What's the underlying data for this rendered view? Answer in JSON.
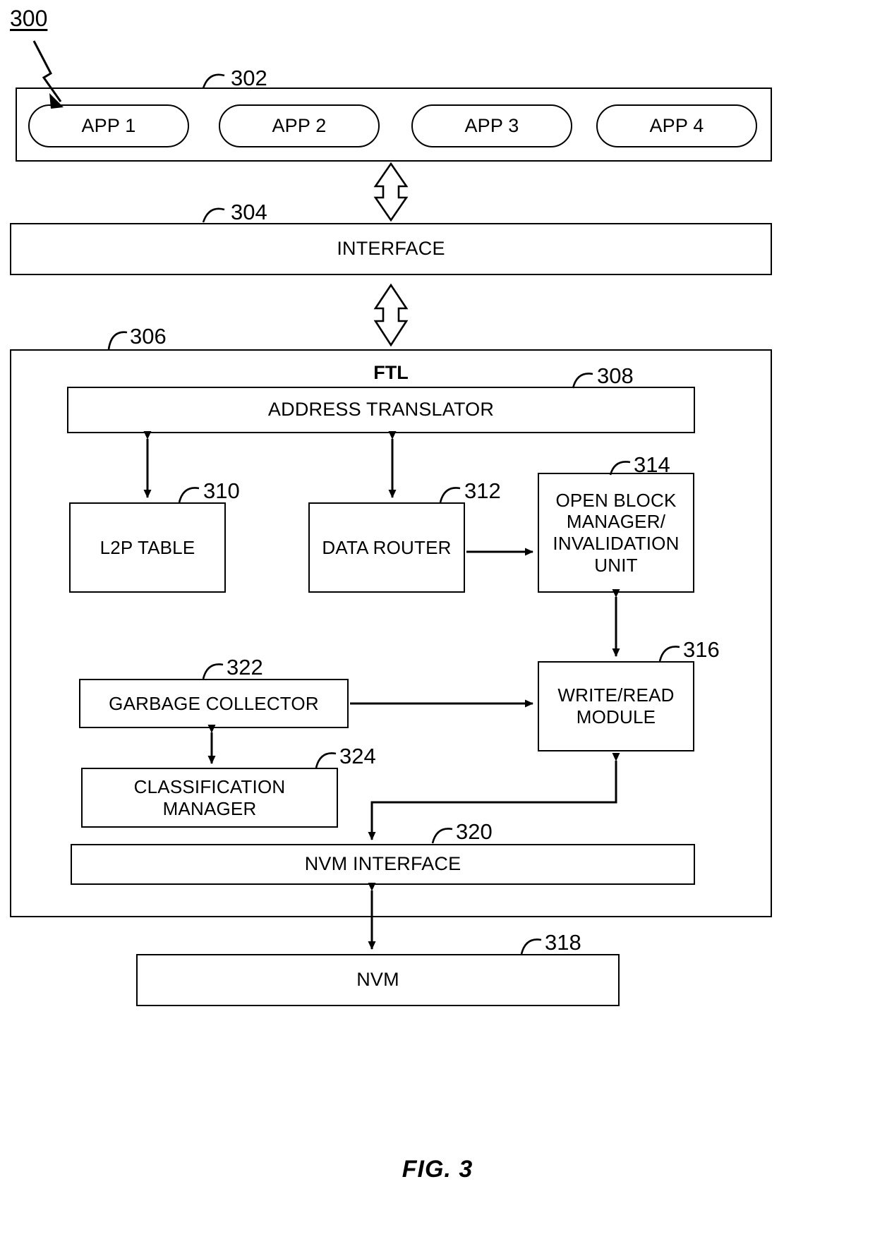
{
  "figure": {
    "caption": "FIG. 3",
    "system_numeral": "300"
  },
  "blocks": {
    "app_layer": {
      "numeral": "302",
      "apps": [
        {
          "label": "APP 1"
        },
        {
          "label": "APP 2"
        },
        {
          "label": "APP 3"
        },
        {
          "label": "APP 4"
        }
      ]
    },
    "interface": {
      "numeral": "304",
      "label": "INTERFACE"
    },
    "ftl": {
      "numeral": "306",
      "label": "FTL"
    },
    "address_translator": {
      "numeral": "308",
      "label": "ADDRESS TRANSLATOR"
    },
    "l2p_table": {
      "numeral": "310",
      "label": "L2P TABLE"
    },
    "data_router": {
      "numeral": "312",
      "label": "DATA ROUTER"
    },
    "open_block_manager": {
      "numeral": "314",
      "label": "OPEN BLOCK\nMANAGER/\nINVALIDATION\nUNIT"
    },
    "write_read_module": {
      "numeral": "316",
      "label": "WRITE/READ\nMODULE"
    },
    "garbage_collector": {
      "numeral": "322",
      "label": "GARBAGE COLLECTOR"
    },
    "classification_manager": {
      "numeral": "324",
      "label": "CLASSIFICATION\nMANAGER"
    },
    "nvm_interface": {
      "numeral": "320",
      "label": "NVM INTERFACE"
    },
    "nvm": {
      "numeral": "318",
      "label": "NVM"
    }
  },
  "colors": {
    "stroke": "#000000",
    "fill": "#ffffff"
  }
}
